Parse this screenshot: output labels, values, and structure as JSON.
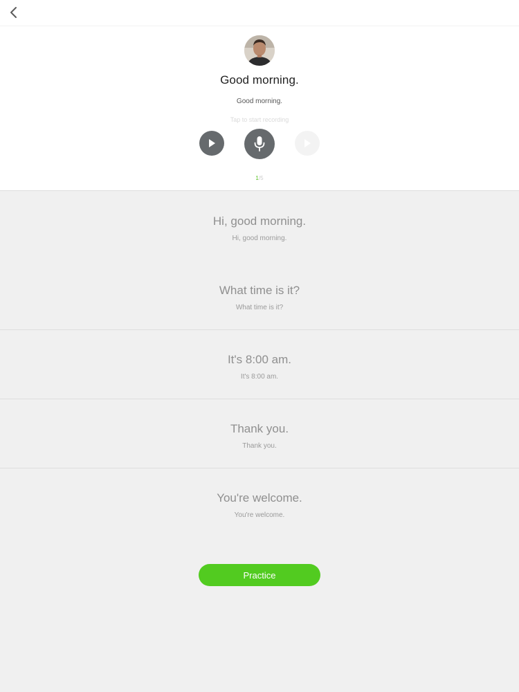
{
  "nav": {
    "back_icon": "chevron-left-icon"
  },
  "active": {
    "title": "Good morning.",
    "subtitle": "Good morning.",
    "record_hint": "Tap to start recording",
    "progress_current": "1",
    "progress_sep": "/",
    "progress_total": "5",
    "buttons": {
      "play_icon": "play-icon",
      "mic_icon": "microphone-icon",
      "playback_icon": "play-icon"
    }
  },
  "sentences": [
    {
      "main": "Hi, good morning.",
      "sub": "Hi, good morning."
    },
    {
      "main": "What time is it?",
      "sub": "What time is it?"
    },
    {
      "main": "It's 8:00 am.",
      "sub": "It's 8:00 am."
    },
    {
      "main": "Thank you.",
      "sub": "Thank you."
    },
    {
      "main": "You're welcome.",
      "sub": "You're welcome."
    }
  ],
  "practice_label": "Practice",
  "colors": {
    "accent": "#52cb20",
    "progress_accent": "#58c322",
    "control": "#666a6d",
    "background": "#f0f0f0"
  }
}
